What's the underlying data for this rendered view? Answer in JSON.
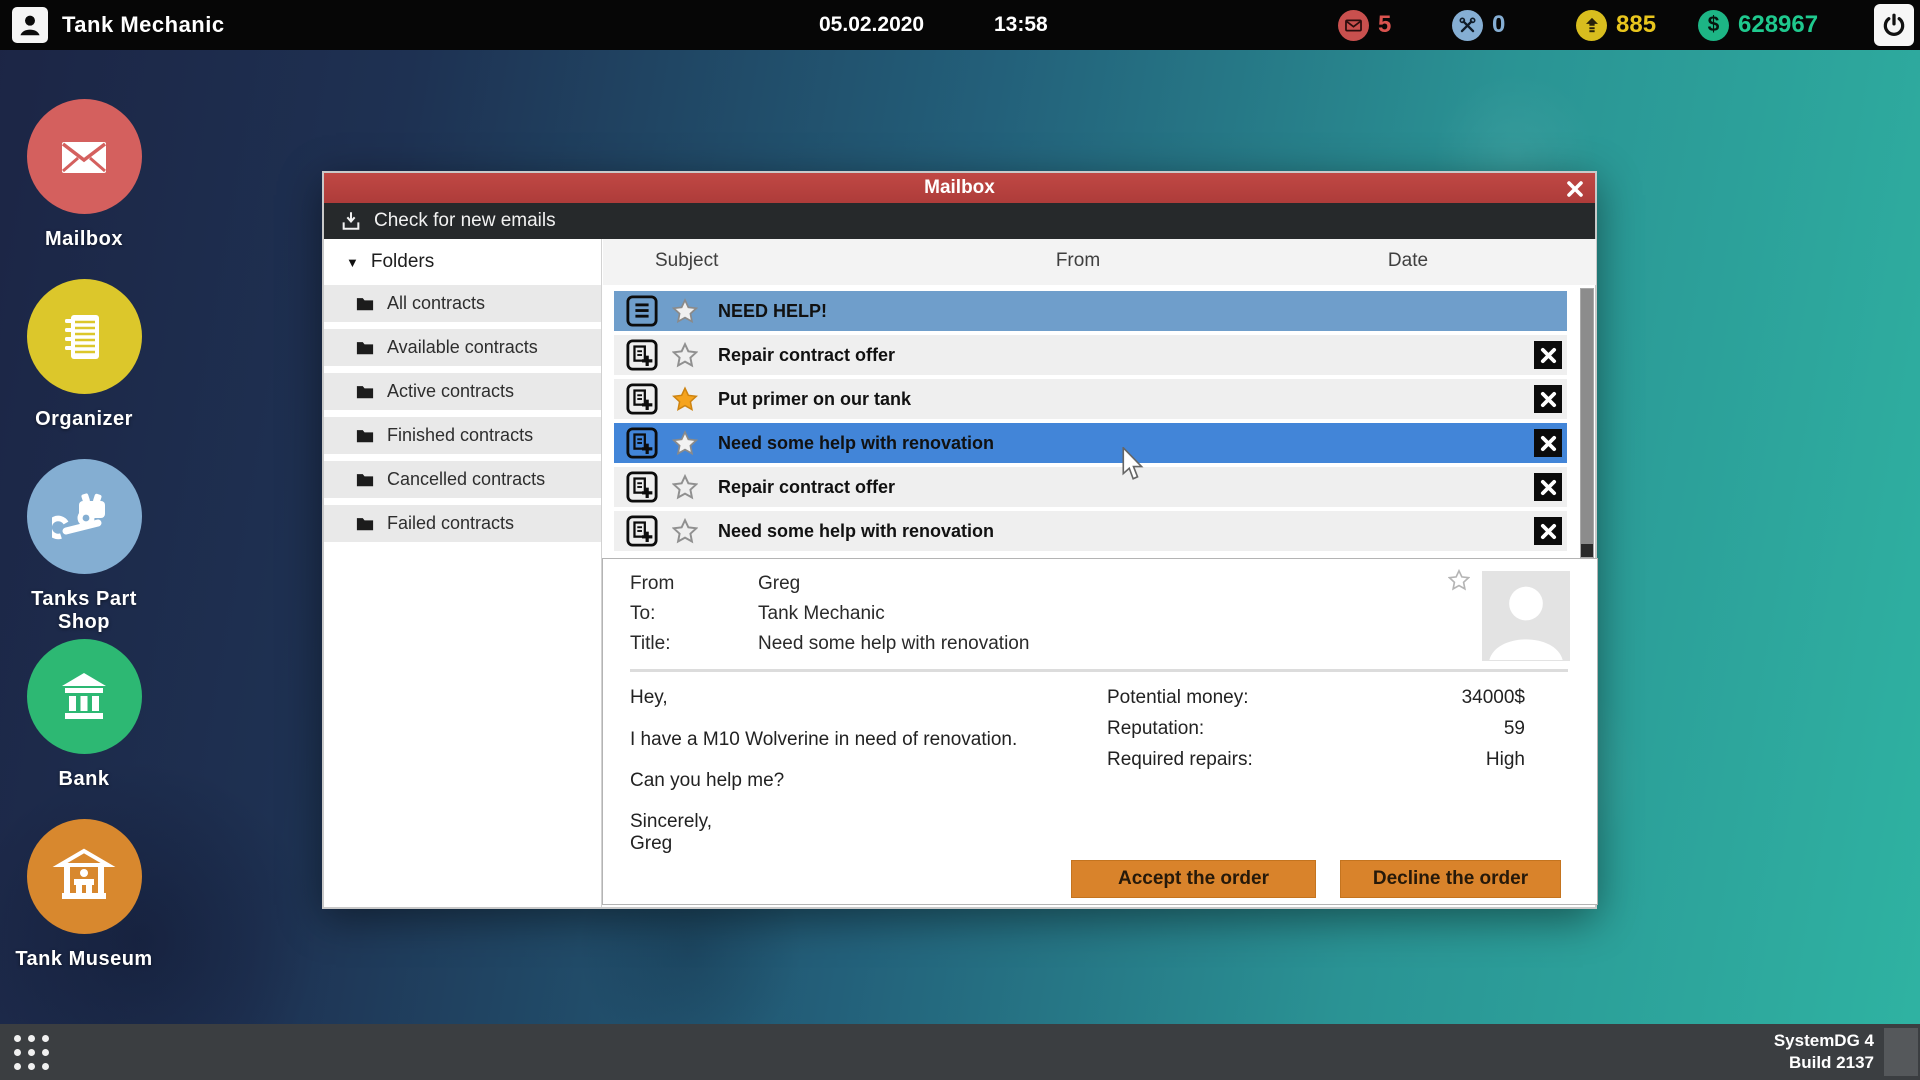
{
  "colors": {
    "titlebar_red": "#b8423f",
    "selected_row_read": "#6f9ecb",
    "selected_row_active": "#4285d8",
    "button_orange": "#d9832b",
    "badge_mail_red": "#c9504e",
    "badge_repairs_blue": "#85aed3",
    "badge_xp_yellow": "#e8c51d",
    "badge_money_green": "#1fc98e",
    "desktop_teal": "#2fb3a2",
    "desktop_navy": "#1c2545"
  },
  "icons": {
    "user-icon": "person silhouette",
    "mail-badge-icon": "envelope",
    "repairs-badge-icon": "crossed wrenches",
    "xp-badge-icon": "rank-up arrow",
    "money-badge-icon": "dollar sign",
    "power-icon": "power symbol",
    "download-icon": "download tray arrow",
    "folder-icon": "folder",
    "doc-lines-icon": "document with lines",
    "doc-plus-icon": "contract with plus",
    "star-icon": "star",
    "delete-x-icon": "black square with white X",
    "close-icon": "white X",
    "apps-grid-icon": "3x3 dot grid",
    "avatar-icon": "person placeholder"
  },
  "top_bar": {
    "title": "Tank Mechanic",
    "date": "05.02.2020",
    "time": "13:58",
    "badges": {
      "mail_count": "5",
      "repairs_count": "0",
      "xp_count": "885",
      "money_count": "628967",
      "dollar_glyph": "$"
    }
  },
  "desktop": {
    "icons": [
      {
        "label": "Mailbox"
      },
      {
        "label": "Organizer"
      },
      {
        "label": "Tanks Part Shop"
      },
      {
        "label": "Bank"
      },
      {
        "label": "Tank Museum"
      }
    ]
  },
  "mailbox_window": {
    "title": "Mailbox",
    "toolbar": {
      "check_label": "Check for new emails"
    },
    "folders": {
      "header": "Folders",
      "triangle": "▼",
      "items": [
        "All contracts",
        "Available contracts",
        "Active contracts",
        "Finished contracts",
        "Cancelled contracts",
        "Failed contracts"
      ]
    },
    "list": {
      "columns": [
        "Subject",
        "From",
        "Date"
      ],
      "emails": [
        {
          "subject": "NEED HELP!",
          "state": "selected-read",
          "star": "gray-filled",
          "deletable": false
        },
        {
          "subject": "Repair contract offer",
          "state": "normal",
          "star": "outline",
          "deletable": true
        },
        {
          "subject": "Put primer on our tank",
          "state": "normal",
          "star": "orange-filled",
          "deletable": true
        },
        {
          "subject": "Need some help with renovation",
          "state": "selected-active",
          "star": "gray-filled",
          "deletable": true
        },
        {
          "subject": "Repair contract offer",
          "state": "normal",
          "star": "outline",
          "deletable": true
        },
        {
          "subject": "Need some help with renovation",
          "state": "normal",
          "star": "outline",
          "deletable": true
        }
      ]
    },
    "detail": {
      "from_label": "From",
      "from_value": "Greg",
      "to_label": "To:",
      "to_value": "Tank Mechanic",
      "title_label": "Title:",
      "title_value": "Need some help with renovation",
      "body_lines": [
        "Hey,",
        "I have a M10 Wolverine in need of renovation.",
        "Can you help me?",
        "Sincerely,",
        "Greg"
      ],
      "stats": [
        {
          "label": "Potential money:",
          "value": "34000$"
        },
        {
          "label": "Reputation:",
          "value": "59"
        },
        {
          "label": "Required repairs:",
          "value": "High"
        }
      ],
      "accept_label": "Accept the order",
      "decline_label": "Decline the order"
    }
  },
  "taskbar": {
    "system_name": "SystemDG 4",
    "build": "Build 2137"
  }
}
